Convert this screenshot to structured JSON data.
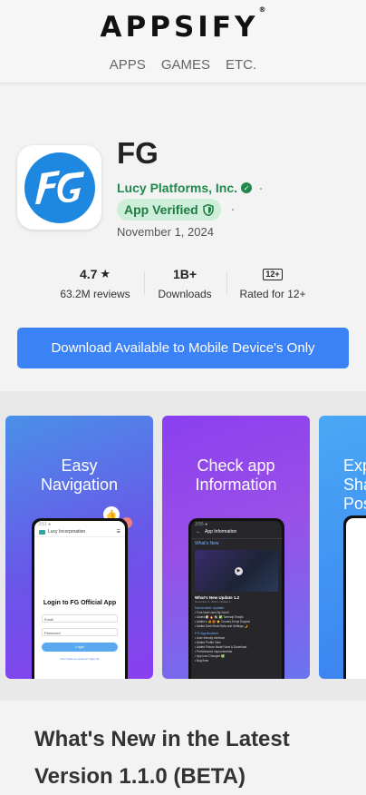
{
  "header": {
    "logo": "APPSIFY",
    "logo_mark": "®",
    "nav": [
      "APPS",
      "GAMES",
      "ETC."
    ]
  },
  "app": {
    "title": "FG",
    "developer": "Lucy Platforms, Inc.",
    "verified_label": "App Verified",
    "date": "November 1, 2024",
    "icon": "fg-logo-icon"
  },
  "stats": {
    "rating": "4.7",
    "rating_icon": "star-icon",
    "reviews": "63.2M reviews",
    "downloads": "1B+",
    "downloads_label": "Downloads",
    "rated_badge": "12+",
    "rated_label": "Rated for 12+"
  },
  "download_button": "Download Available to Mobile Device's Only",
  "screenshots": [
    {
      "caption_line1": "Easy",
      "caption_line2": "Navigation",
      "phone_header": "Lucy Incorporation",
      "login_title": "Login to FG Official App",
      "email_placeholder": "Email",
      "password_placeholder": "Password",
      "login_button": "Login",
      "signup_link": "Don't have an account? Sign Up"
    },
    {
      "caption_line1": "Check app",
      "caption_line2": "Information",
      "phone_header": "App Information",
      "whats_new": "What's New",
      "update_title": "What's New Update 1.2",
      "update_sub": "November 2, 2024 • Update 2",
      "section1": "November Update",
      "bullets1": [
        "• Font Now Used By Scroll",
        "• Added 🎲 🔥 🐘 ✅ Twemoji Emojis",
        "• Added ♦ 🐠 🏀 ⭐ Country Emoji Support",
        "• Added Dark Mode Beta and Settings 🌙"
      ],
      "section2": "FG Application",
      "bullets2": [
        "• User-friendly interface",
        "• Added Profile View",
        "• Added Picture Model View & Download",
        "• Performance improvements",
        "• App Icon Changed ✅",
        "• Bug fixes"
      ]
    },
    {
      "caption_line1": "Exp",
      "caption_line2": "Sha",
      "caption_line3": "Pos"
    }
  ],
  "whats_new_heading": "What's New in the Latest Version 1.1.0 (BETA)",
  "colors": {
    "accent": "#3b82f6",
    "developer_green": "#1f8a4c",
    "verified_bg": "#cdeed8",
    "icon_blue": "#1e87e0"
  }
}
